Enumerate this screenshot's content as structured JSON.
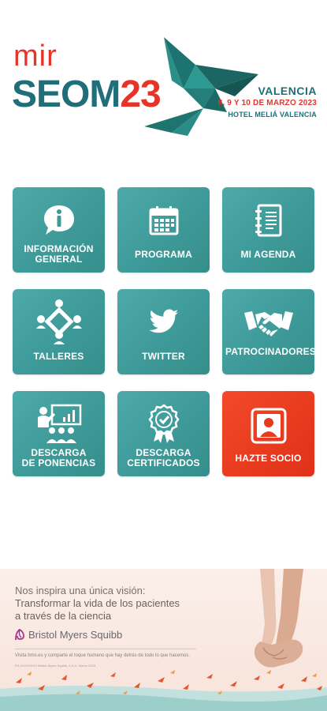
{
  "header": {
    "brand_top": "mir",
    "brand_main_a": "SEOM",
    "brand_main_b": "23",
    "city": "VALENCIA",
    "dates": "8, 9 Y 10 DE MARZO 2023",
    "venue": "HOTEL MELIÁ VALENCIA"
  },
  "tiles": [
    {
      "label_1": "INFORMACIÓN",
      "label_2": "GENERAL",
      "icon": "info-speech-bubble-icon"
    },
    {
      "label_1": "PROGRAMA",
      "icon": "calendar-icon"
    },
    {
      "label_1": "MI AGENDA",
      "icon": "notebook-icon"
    },
    {
      "label_1": "TALLERES",
      "icon": "workshop-people-icon"
    },
    {
      "label_1": "TWITTER",
      "icon": "twitter-bird-icon"
    },
    {
      "label_1": "PATROCINADORES",
      "icon": "handshake-icon"
    },
    {
      "label_1": "DESCARGA",
      "label_2": "DE PONENCIAS",
      "icon": "presentation-icon"
    },
    {
      "label_1": "DESCARGA",
      "label_2": "CERTIFICADOS",
      "icon": "certificate-badge-icon"
    },
    {
      "label_1": "HAZTE SOCIO",
      "icon": "member-profile-icon"
    }
  ],
  "ad": {
    "line1": "Nos inspira una única visión:",
    "line2": "Transformar la vida de los pacientes",
    "line3": "a través de la ciencia",
    "brand": "Bristol Myers Squibb",
    "small_text": "Visita bms.es y comparte el toque humano que hay detrás de todo lo que hacemos.",
    "tiny_text": "ES-XXXXXXXX Bristol-Myers Squibb, S.A.U. Marzo 2023"
  },
  "colors": {
    "teal_tile": "#3e9a98",
    "red_tile": "#e83a1e",
    "brand_teal": "#1f6e79",
    "brand_red": "#e63528"
  }
}
